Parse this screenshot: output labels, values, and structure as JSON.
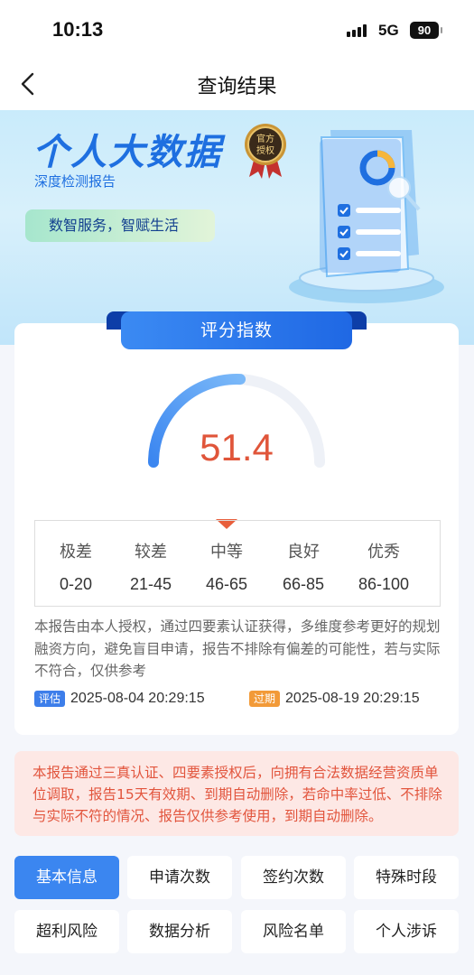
{
  "status_bar": {
    "time": "10:13",
    "network": "5G",
    "battery": "90"
  },
  "nav": {
    "title": "查询结果"
  },
  "hero": {
    "title": "个人大数据",
    "subtitle": "深度检测报告",
    "seal_text": "官方授权",
    "slogan": "数智服务，智赋生活"
  },
  "score_card": {
    "header": "评分指数",
    "score": "51.4",
    "score_fraction": 0.514,
    "grades": [
      {
        "name": "极差",
        "range": "0-20",
        "active": false
      },
      {
        "name": "较差",
        "range": "21-45",
        "active": false
      },
      {
        "name": "中等",
        "range": "46-65",
        "active": true
      },
      {
        "name": "良好",
        "range": "66-85",
        "active": false
      },
      {
        "name": "优秀",
        "range": "86-100",
        "active": false
      }
    ],
    "description": "本报告由本人授权，通过四要素认证获得，多维度参考更好的规划融资方向，避免盲目申请，报告不排除有偏差的可能性，若与实际不符合，仅供参考",
    "eval_label": "评估",
    "eval_date": "2025-08-04 20:29:15",
    "expire_label": "过期",
    "expire_date": "2025-08-19 20:29:15"
  },
  "notice": "本报告通过三真认证、四要素授权后，向拥有合法数据经营资质单位调取，报告15天有效期、到期自动删除，若命中率过低、不排除与实际不符的情况、报告仅供参考使用，到期自动删除。",
  "tabs": [
    {
      "label": "基本信息",
      "active": true
    },
    {
      "label": "申请次数",
      "active": false
    },
    {
      "label": "签约次数",
      "active": false
    },
    {
      "label": "特殊时段",
      "active": false
    },
    {
      "label": "超利风险",
      "active": false
    },
    {
      "label": "数据分析",
      "active": false
    },
    {
      "label": "风险名单",
      "active": false
    },
    {
      "label": "个人涉诉",
      "active": false
    }
  ],
  "colors": {
    "accent": "#3b86f0",
    "score": "#e0553a",
    "notice_bg": "#fde8e5"
  },
  "icons": [
    "back-arrow-icon",
    "signal-icon",
    "battery-icon",
    "official-seal-icon",
    "report-document-icon"
  ]
}
